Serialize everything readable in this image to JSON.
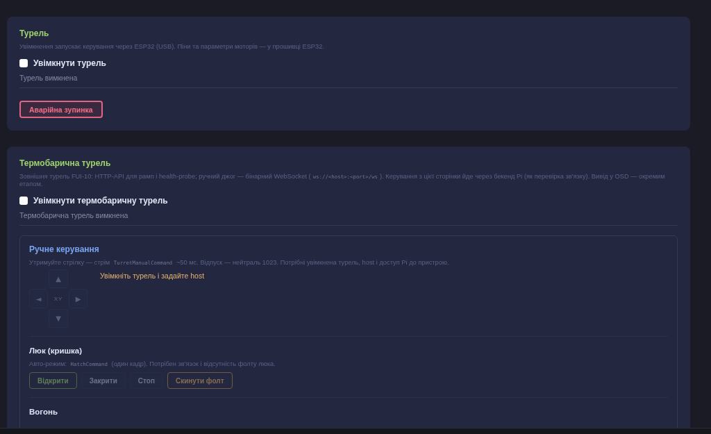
{
  "cards": [
    {
      "title": "Турель",
      "description": [
        {
          "kind": "text",
          "text": "Увімкнення запускає керування через ESP32 (USB). Піни та параметри моторів — у прошивці ESP32."
        }
      ],
      "enable": {
        "label": "Увімкнути турель",
        "checked": false
      },
      "status": "Турель вимкнена",
      "buttons": [
        {
          "label": "Аварійна зупинка",
          "kind": "danger",
          "disabled": false
        }
      ]
    },
    {
      "title": "Термобарична турель",
      "description": [
        {
          "kind": "text",
          "text": "Зовнішня турель FUI-10: HTTP-API для рамп і health-probe; ручний джог — бінарний WebSocket ("
        },
        {
          "kind": "code",
          "text": "ws://<host>:<port>/ws"
        },
        {
          "kind": "text",
          "text": "). Керування з цієї сторінки йде через бекенд Pi (як перевірка зв'язку). Вивід у OSD — окремим етапом."
        }
      ],
      "enable": {
        "label": "Увімкнути термобаричну турель",
        "checked": false
      },
      "status": "Термобарична турель вимкнена",
      "manual_panel": {
        "title": "Ручне керування",
        "description": [
          {
            "kind": "text",
            "text": "Утримуйте стрілку — стрім "
          },
          {
            "kind": "code",
            "text": "TurretManualCommand"
          },
          {
            "kind": "text",
            "text": " ~50 мс. Відпуск — нейтраль 1023. Потрібні увімкнена турель, host і доступ Pi до пристрою."
          }
        ],
        "dpad": [
          {
            "label": "▲",
            "kind": "up",
            "disabled": true
          },
          {
            "label": "◄",
            "kind": "left",
            "disabled": true
          },
          {
            "label": "XY",
            "kind": "center",
            "disabled": true
          },
          {
            "label": "▶",
            "kind": "right",
            "disabled": true
          },
          {
            "label": "▼",
            "kind": "down",
            "disabled": true
          }
        ],
        "message": "Увімкніть турель і задайте host",
        "sections": [
          {
            "title": "Люк (кришка)",
            "description": [
              {
                "kind": "text",
                "text": "Авто-режим: "
              },
              {
                "kind": "code",
                "text": "HatchCommand"
              },
              {
                "kind": "text",
                "text": " (один кадр). Потрібен зв'язок і відсутність фолту люка."
              }
            ],
            "buttons": [
              {
                "label": "Відкрити",
                "kind": "success",
                "disabled": true
              },
              {
                "label": "Закрити",
                "kind": "default",
                "disabled": true
              },
              {
                "label": "Стоп",
                "kind": "default",
                "disabled": true
              },
              {
                "label": "Скинути фолт",
                "kind": "warning",
                "disabled": true
              }
            ]
          },
          {
            "title": "Вогонь"
          }
        ]
      }
    }
  ]
}
